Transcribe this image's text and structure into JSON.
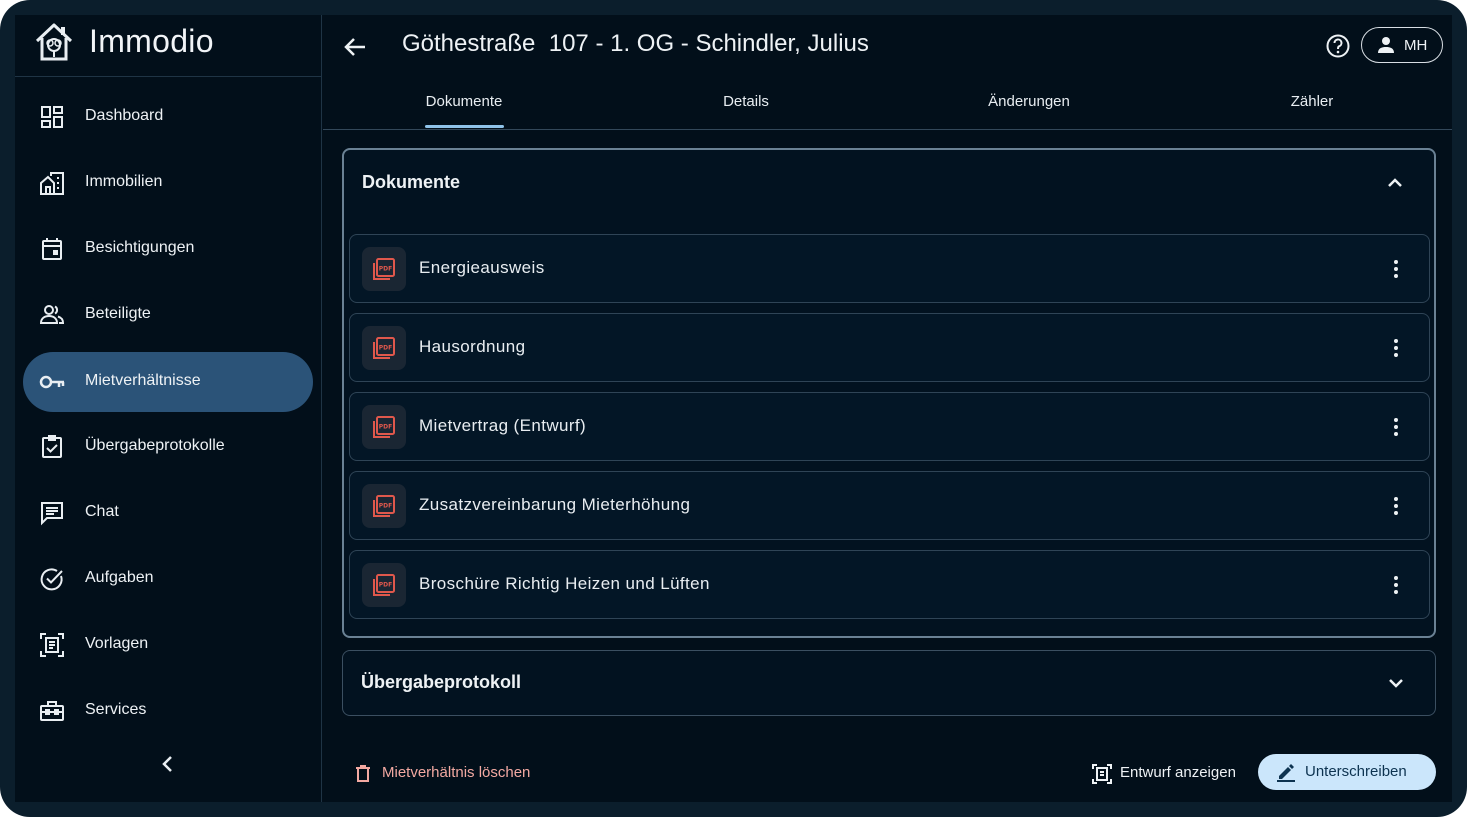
{
  "app": {
    "name": "Immodio"
  },
  "sidebar": {
    "items": [
      {
        "label": "Dashboard",
        "icon": "dashboard-icon"
      },
      {
        "label": "Immobilien",
        "icon": "building-icon"
      },
      {
        "label": "Besichtigungen",
        "icon": "calendar-icon"
      },
      {
        "label": "Beteiligte",
        "icon": "people-icon"
      },
      {
        "label": "Mietverhältnisse",
        "icon": "key-icon",
        "active": true
      },
      {
        "label": "Übergabeprotokolle",
        "icon": "checklist-icon"
      },
      {
        "label": "Chat",
        "icon": "chat-icon"
      },
      {
        "label": "Aufgaben",
        "icon": "check-circle-icon"
      },
      {
        "label": "Vorlagen",
        "icon": "template-icon"
      },
      {
        "label": "Services",
        "icon": "toolbox-icon"
      }
    ]
  },
  "header": {
    "title": "Göthestraße  107 - 1. OG - Schindler, Julius",
    "user_initials": "MH"
  },
  "tabs": [
    {
      "label": "Dokumente",
      "active": true
    },
    {
      "label": "Details"
    },
    {
      "label": "Änderungen"
    },
    {
      "label": "Zähler"
    }
  ],
  "sections": {
    "documents": {
      "title": "Dokumente",
      "expanded": true,
      "items": [
        {
          "label": "Energieausweis",
          "icon": "pdf-icon"
        },
        {
          "label": "Hausordnung",
          "icon": "pdf-icon"
        },
        {
          "label": "Mietvertrag (Entwurf)",
          "icon": "pdf-icon"
        },
        {
          "label": "Zusatzvereinbarung Mieterhöhung",
          "icon": "pdf-icon"
        },
        {
          "label": "Broschüre Richtig Heizen und Lüften",
          "icon": "pdf-icon"
        }
      ]
    },
    "handover": {
      "title": "Übergabeprotokoll",
      "expanded": false
    }
  },
  "actions": {
    "delete_label": "Mietverhältnis löschen",
    "preview_label": "Entwurf anzeigen",
    "sign_label": "Unterschreiben"
  },
  "colors": {
    "background": "#020f1a",
    "active_nav": "#2b5378",
    "primary_button": "#cbe6fb",
    "danger_text": "#f3a9a2",
    "pdf_red": "#e0584c"
  }
}
